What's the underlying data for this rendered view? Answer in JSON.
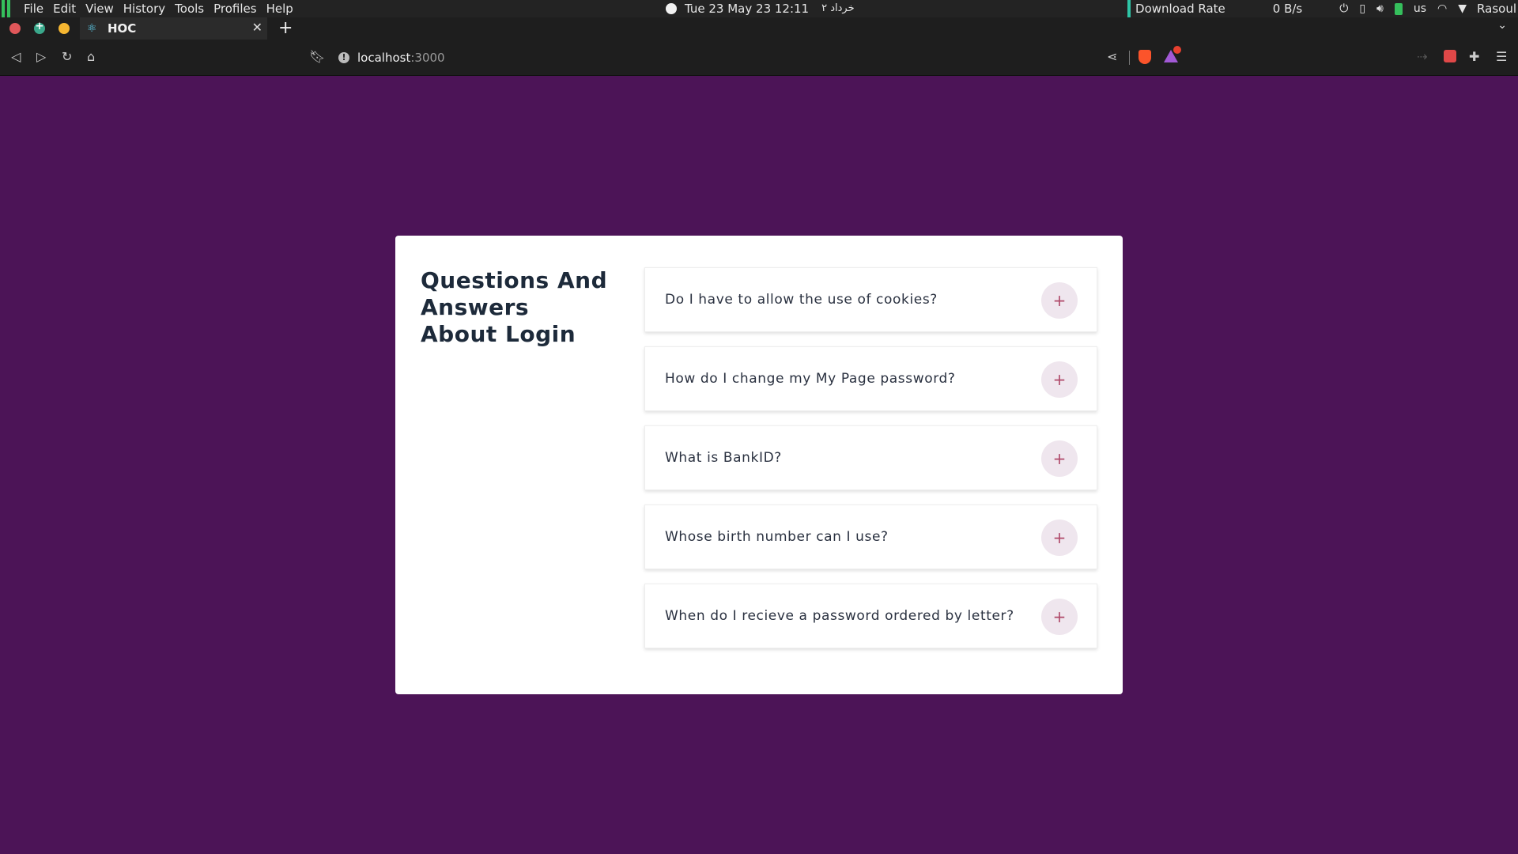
{
  "system_bar": {
    "menus": [
      "File",
      "Edit",
      "View",
      "History",
      "Tools",
      "Profiles",
      "Help"
    ],
    "clock": "Tue 23 May 23  12:11",
    "persian_date": "۲ خرداد",
    "download_rate_label": "Download Rate",
    "download_rate_value": "0 B/s",
    "keyboard_layout": "us",
    "user": "Rasoul"
  },
  "browser": {
    "tab_title": "HOC",
    "url_host": "localhost",
    "url_port": ":3000"
  },
  "faq": {
    "title": "Questions And Answers About Login",
    "items": [
      {
        "question": "Do I have to allow the use of cookies?",
        "toggle": "+"
      },
      {
        "question": "How do I change my My Page password?",
        "toggle": "+"
      },
      {
        "question": "What is BankID?",
        "toggle": "+"
      },
      {
        "question": "Whose birth number can I use?",
        "toggle": "+"
      },
      {
        "question": "When do I recieve a password ordered by letter?",
        "toggle": "+"
      }
    ]
  },
  "colors": {
    "page_background": "#4c1457",
    "card_background": "#ffffff",
    "toggle_background": "#efe6ee",
    "toggle_plus": "#b04a6a"
  }
}
